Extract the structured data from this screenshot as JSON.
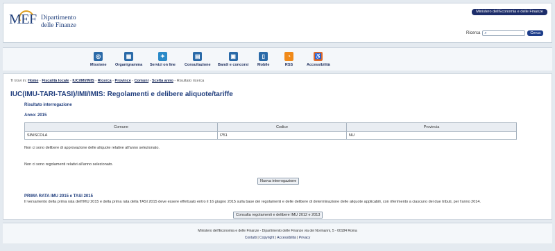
{
  "header": {
    "logo_mark": "MEF",
    "logo_line1": "Dipartimento",
    "logo_line2": "delle Finanze",
    "ministry_label": "Ministero dell'Economia e delle Finanze",
    "search_label": "Ricerca",
    "search_placeholder": "",
    "search_button": "Cerca"
  },
  "toolbar": {
    "items": [
      {
        "label": "Missione",
        "icon": "target-icon",
        "color": "#2a6aa8"
      },
      {
        "label": "Organigramma",
        "icon": "org-chart-icon",
        "color": "#2a6aa8"
      },
      {
        "label": "Servizi on line",
        "icon": "twitter-icon",
        "color": "#2a8ac8"
      },
      {
        "label": "Consultazione",
        "icon": "consult-icon",
        "color": "#2a6aa8"
      },
      {
        "label": "Bandi e concorsi",
        "icon": "announce-icon",
        "color": "#2a6aa8"
      },
      {
        "label": "Mobile",
        "icon": "mobile-icon",
        "color": "#2a6aa8"
      },
      {
        "label": "RSS",
        "icon": "rss-icon",
        "color": "#f08a1a"
      },
      {
        "label": "Accessibilità",
        "icon": "accessibility-icon",
        "color": "#e06a2a"
      }
    ]
  },
  "breadcrumb": {
    "prefix": "Ti trovi in:",
    "items": [
      "Home",
      "Fiscalità locale",
      "IUC/IMI/IMIS",
      "Ricerca",
      "Province",
      "Comuni",
      "Scelta anno"
    ],
    "current": "Risultato ricerca"
  },
  "main": {
    "title": "IUC(IMU-TARI-TASI)/IMI/IMIS: Regolamenti e delibere aliquote/tariffe",
    "result_heading": "Risultato interrogazione",
    "year_label": "Anno: 2015",
    "table": {
      "headers": [
        "Comune",
        "Codice",
        "Provincia"
      ],
      "rows": [
        [
          "SINISCOLA",
          "I751",
          "NU"
        ]
      ]
    },
    "msg_delibere": "Non ci sono delibere di approvazione delle aliquote relative all'anno selezionato.",
    "msg_regolamenti": "Non ci sono regolamenti relativi all'anno selezionato.",
    "new_query_button": "Nuova interrogazione",
    "notice_title": "PRIMA RATA IMU 2015 e TASI 2015",
    "notice_text": "Il versamento della prima rata dell'IMU 2015 e della prima rata della TASI 2015 deve essere effettuato entro il 16 giugno 2015 sulla base dei regolamenti e delle delibere di determinazione delle aliquote applicabili, con riferimento a ciascuno dei due tributi, per l'anno 2014.",
    "consult_button": "Consulta regolamenti e delibere IMU 2012 e 2013"
  },
  "footer": {
    "address": "Ministero dell'Economia e delle Finanze - Dipartimento delle Finanze via dei Normanni, 5 - 00184 Roma",
    "links": [
      "Contatti",
      "Copyright",
      "Accessibilità",
      "Privacy"
    ]
  }
}
